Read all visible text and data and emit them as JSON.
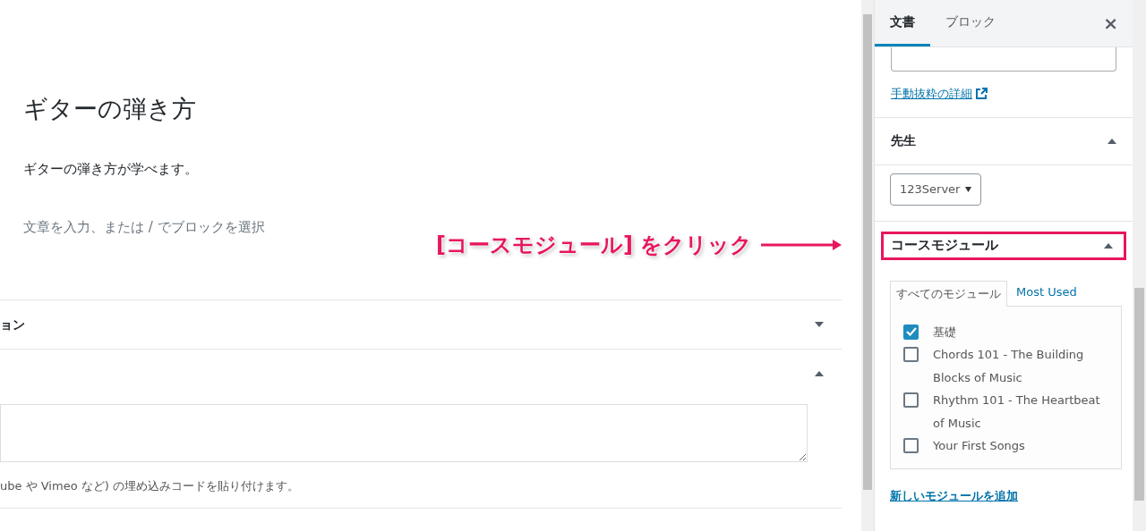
{
  "editor": {
    "title": "ギターの弾き方",
    "paragraph": "ギターの弾き方が学べます。",
    "placeholder": "文章を入力、または / でブロックを選択"
  },
  "meta_panels": [
    {
      "title": "ョン",
      "expanded": false
    },
    {
      "expanded": true,
      "help": "ube や Vimeo など) の埋め込みコードを貼り付けます。"
    }
  ],
  "annotation": {
    "text": "[コースモジュール] をクリック"
  },
  "sidebar": {
    "tabs": [
      {
        "label": "文書",
        "selected": true
      },
      {
        "label": "ブロック",
        "selected": false
      }
    ],
    "close": "×",
    "excerpt_link": "手動抜粋の詳細",
    "panels": [
      {
        "title": "先生",
        "expanded": true,
        "select": "123Server"
      },
      {
        "title": "コースモジュール",
        "expanded": true,
        "highlighted": true,
        "tabs": [
          {
            "label": "すべてのモジュール",
            "selected": true
          },
          {
            "label": "Most Used",
            "selected": false
          }
        ],
        "modules": [
          {
            "label": "基礎",
            "checked": true
          },
          {
            "label": "Chords 101 - The Building Blocks of Music",
            "checked": false
          },
          {
            "label": "Rhythm 101 - The Heartbeat of Music",
            "checked": false
          },
          {
            "label": "Your First Songs",
            "checked": false
          }
        ],
        "add_link": "新しいモジュールを追加"
      }
    ]
  }
}
